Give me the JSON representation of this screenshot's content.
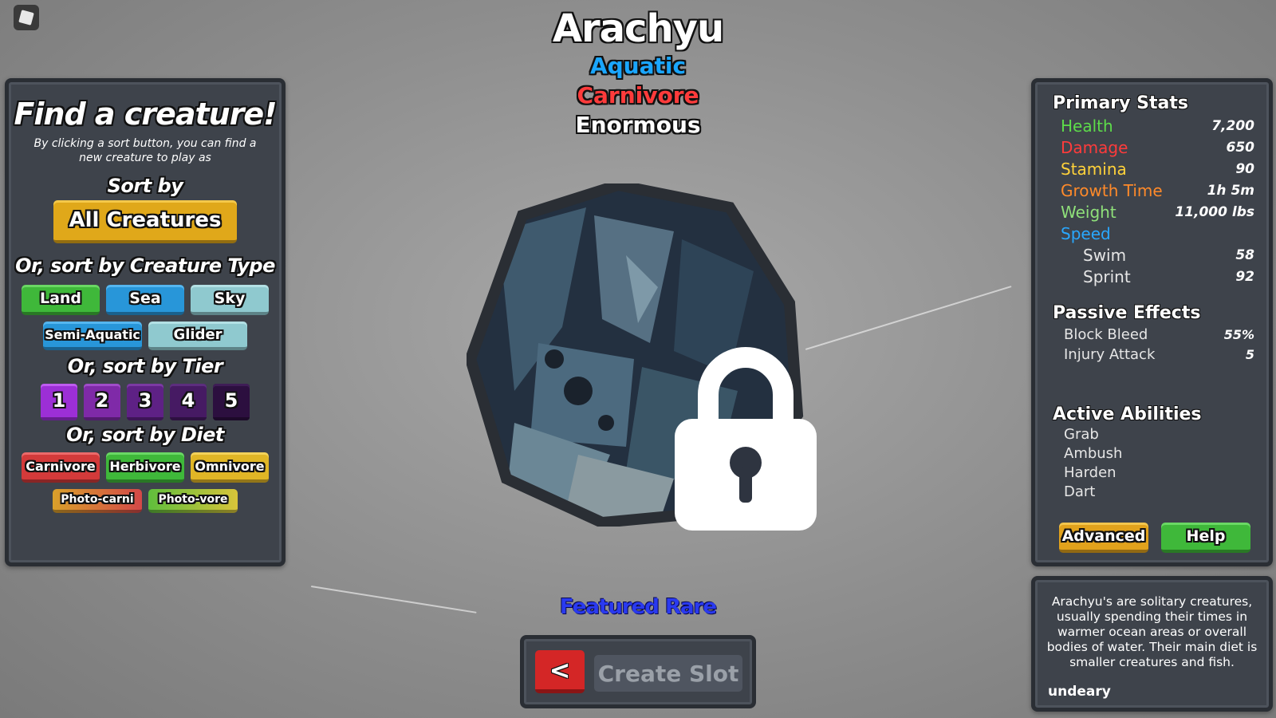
{
  "creature": {
    "name": "Arachyu",
    "habitat": "Aquatic",
    "diet": "Carnivore",
    "size": "Enormous"
  },
  "colors": {
    "aquatic": "#1aa6ff",
    "carnivore": "#ff3b3b",
    "health": "#5ddc4a",
    "damage": "#ff3b3b",
    "stamina": "#ffd23a",
    "growth": "#ff8a2a",
    "weight": "#8fe07a",
    "speed": "#29a8ff",
    "featured": "#2a3af0"
  },
  "left_panel": {
    "title": "Find a creature!",
    "subtitle": "By clicking a sort button, you can find a new creature to play as",
    "sort_by": "Sort by",
    "all_creatures": "All Creatures",
    "type_heading": "Or, sort by Creature Type",
    "types": [
      "Land",
      "Sea",
      "Sky",
      "Semi-Aquatic",
      "Glider"
    ],
    "tier_heading": "Or, sort by Tier",
    "tiers": [
      "1",
      "2",
      "3",
      "4",
      "5"
    ],
    "diet_heading": "Or, sort by Diet",
    "diets": [
      "Carnivore",
      "Herbivore",
      "Omnivore",
      "Photo-carni",
      "Photo-vore"
    ]
  },
  "stats": {
    "primary_heading": "Primary Stats",
    "health_label": "Health",
    "health": "7,200",
    "damage_label": "Damage",
    "damage": "650",
    "stamina_label": "Stamina",
    "stamina": "90",
    "growth_label": "Growth Time",
    "growth": "1h 5m",
    "weight_label": "Weight",
    "weight": "11,000 lbs",
    "speed_label": "Speed",
    "swim_label": "Swim",
    "swim": "58",
    "sprint_label": "Sprint",
    "sprint": "92",
    "passive_heading": "Passive Effects",
    "passives": [
      {
        "label": "Block Bleed",
        "value": "55%"
      },
      {
        "label": "Injury Attack",
        "value": "5"
      }
    ],
    "active_heading": "Active Abilities",
    "abilities": [
      "Grab",
      "Ambush",
      "Harden",
      "Dart"
    ],
    "advanced": "Advanced",
    "help": "Help"
  },
  "description": {
    "text": "Arachyu's are solitary creatures, usually spending their times in warmer ocean areas or overall bodies of water. Their main diet is smaller creatures and fish.",
    "author": "undeary"
  },
  "bottom": {
    "featured": "Featured Rare",
    "back": "<",
    "create_slot": "Create Slot"
  },
  "icons": [
    "roblox-menu-icon",
    "lock-icon"
  ]
}
